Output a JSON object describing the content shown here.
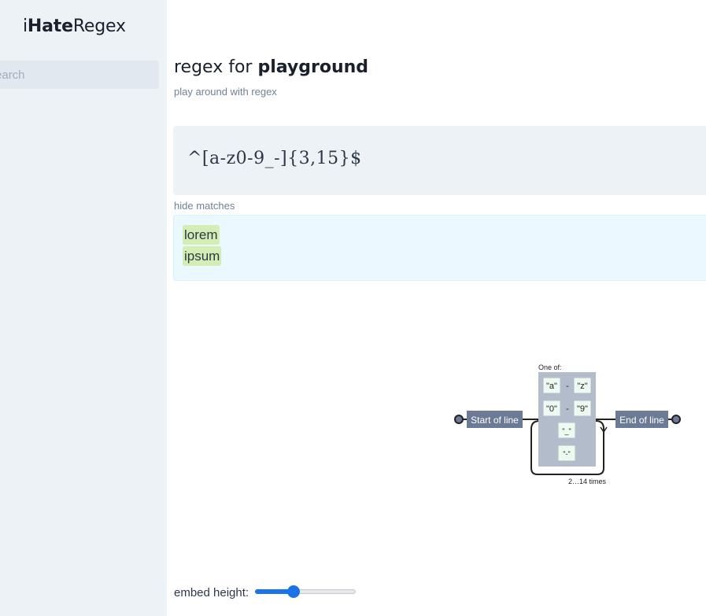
{
  "sidebar": {
    "logo_bold": "iHate",
    "logo_rest": "Regex",
    "logo_prefix": "i",
    "search_placeholder": "Search"
  },
  "main": {
    "title_prefix": "regex for ",
    "title_bold": "playground",
    "subtitle": "play around with regex",
    "regex": "^[a-z0-9_-]{3,15}$",
    "toggle_label": "hide matches",
    "matches": [
      "lorem",
      "ipsum"
    ]
  },
  "diagram": {
    "start_label": "Start of line",
    "end_label": "End of line",
    "group_label": "One of:",
    "range1_from": "\"a\"",
    "range1_to": "\"z\"",
    "range2_from": "\"0\"",
    "range2_to": "\"9\"",
    "range_sep": "-",
    "char1": "\"_\"",
    "char2": "\"-\"",
    "repeat_label": "2…14 times"
  },
  "embed": {
    "label": "embed height:",
    "value_fraction": 0.38
  },
  "colors": {
    "accent": "#1a73e8",
    "match_highlight": "#d4edb4",
    "diagram_node": "#6b7a95"
  }
}
